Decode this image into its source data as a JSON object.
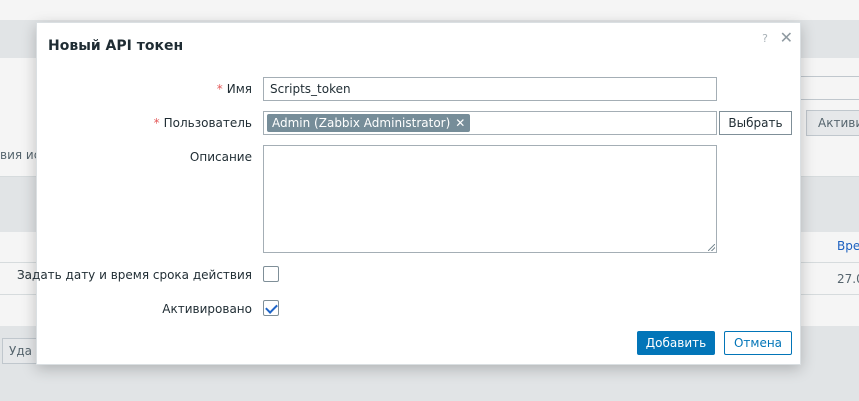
{
  "background": {
    "partial_text_left": "вия ис",
    "partial_button_right": "Активир",
    "partial_column_header_right": "Вре",
    "partial_cell_right": "27.0",
    "partial_button_bottom_left": "Уда"
  },
  "dialog": {
    "title": "Новый API токен",
    "help_icon": "?",
    "close_icon": "✕",
    "required_mark": "*",
    "fields": {
      "name": {
        "label": "Имя",
        "value": "Scripts_token"
      },
      "user": {
        "label": "Пользователь",
        "tag": "Admin (Zabbix Administrator)",
        "tag_remove": "✕",
        "select_button": "Выбрать"
      },
      "description": {
        "label": "Описание",
        "value": ""
      },
      "expiry": {
        "label": "Задать дату и время срока действия",
        "checked": false
      },
      "enabled": {
        "label": "Активировано",
        "checked": true
      }
    },
    "buttons": {
      "add": "Добавить",
      "cancel": "Отмена"
    }
  },
  "colors": {
    "primary": "#0275b8",
    "required": "#e45959",
    "tag_bg": "#768d99"
  }
}
